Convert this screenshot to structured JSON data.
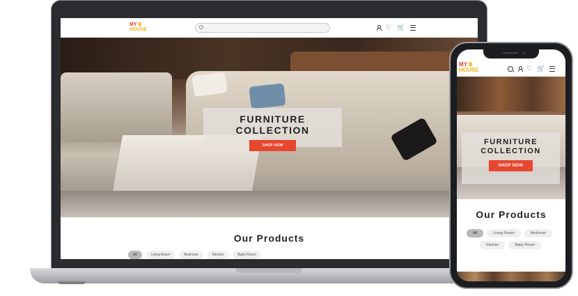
{
  "brand": {
    "line1": "MY",
    "line2": "HOUSE",
    "primary_color": "#e53b2c",
    "secondary_color": "#f2b417"
  },
  "search": {
    "placeholder": ""
  },
  "header_icons": [
    "user-icon",
    "heart-icon",
    "cart-icon",
    "menu-icon"
  ],
  "mobile_header_icons": [
    "search-icon",
    "user-icon",
    "heart-icon",
    "cart-icon",
    "menu-icon"
  ],
  "hero": {
    "title_line1": "FURNITURE",
    "title_line2": "COLLECTION",
    "title": "FURNITURE COLLECTION",
    "button": "SHOP NOW",
    "button_color": "#e8472f"
  },
  "products": {
    "title": "Our Products",
    "categories": [
      "All",
      "Living Room",
      "Bedroom",
      "Kitchen",
      "Baby Room"
    ],
    "active": "All"
  }
}
